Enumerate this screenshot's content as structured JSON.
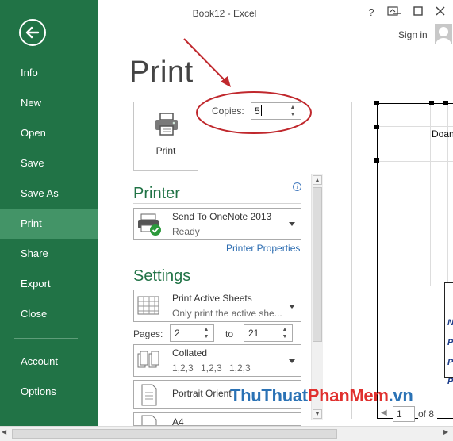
{
  "window": {
    "title": "Book12 - Excel",
    "help_label": "?",
    "signin_label": "Sign in"
  },
  "nav": {
    "items": [
      {
        "label": "Info"
      },
      {
        "label": "New"
      },
      {
        "label": "Open"
      },
      {
        "label": "Save"
      },
      {
        "label": "Save As"
      },
      {
        "label": "Print"
      },
      {
        "label": "Share"
      },
      {
        "label": "Export"
      },
      {
        "label": "Close"
      },
      {
        "label": "Account"
      },
      {
        "label": "Options"
      }
    ],
    "active": "Print"
  },
  "print": {
    "page_title": "Print",
    "print_button_label": "Print",
    "copies_label": "Copies:",
    "copies_value": "5"
  },
  "printer": {
    "section_title": "Printer",
    "name": "Send To OneNote 2013",
    "status": "Ready",
    "properties_link": "Printer Properties",
    "info_icon": "i"
  },
  "settings": {
    "section_title": "Settings",
    "scope": {
      "main": "Print Active Sheets",
      "sub": "Only print the active she..."
    },
    "pages_label": "Pages:",
    "pages_from": "2",
    "pages_to_label": "to",
    "pages_to": "21",
    "collation": {
      "main": "Collated",
      "sub": [
        "1,2,3",
        "1,2,3",
        "1,2,3"
      ]
    },
    "orientation": {
      "main": "Portrait Orient"
    },
    "paper": {
      "main": "A4"
    }
  },
  "preview": {
    "cell_text": "Doan",
    "row_letters": [
      "N",
      "P",
      "P",
      "P"
    ],
    "current_page": "1",
    "page_total_label": "of 8"
  },
  "watermark": {
    "text_a": "ThuThuat",
    "text_b": "PhanMem",
    "text_c": ".vn"
  },
  "colors": {
    "accent": "#217346",
    "active_nav": "#439467",
    "annotation": "#c0282d"
  }
}
